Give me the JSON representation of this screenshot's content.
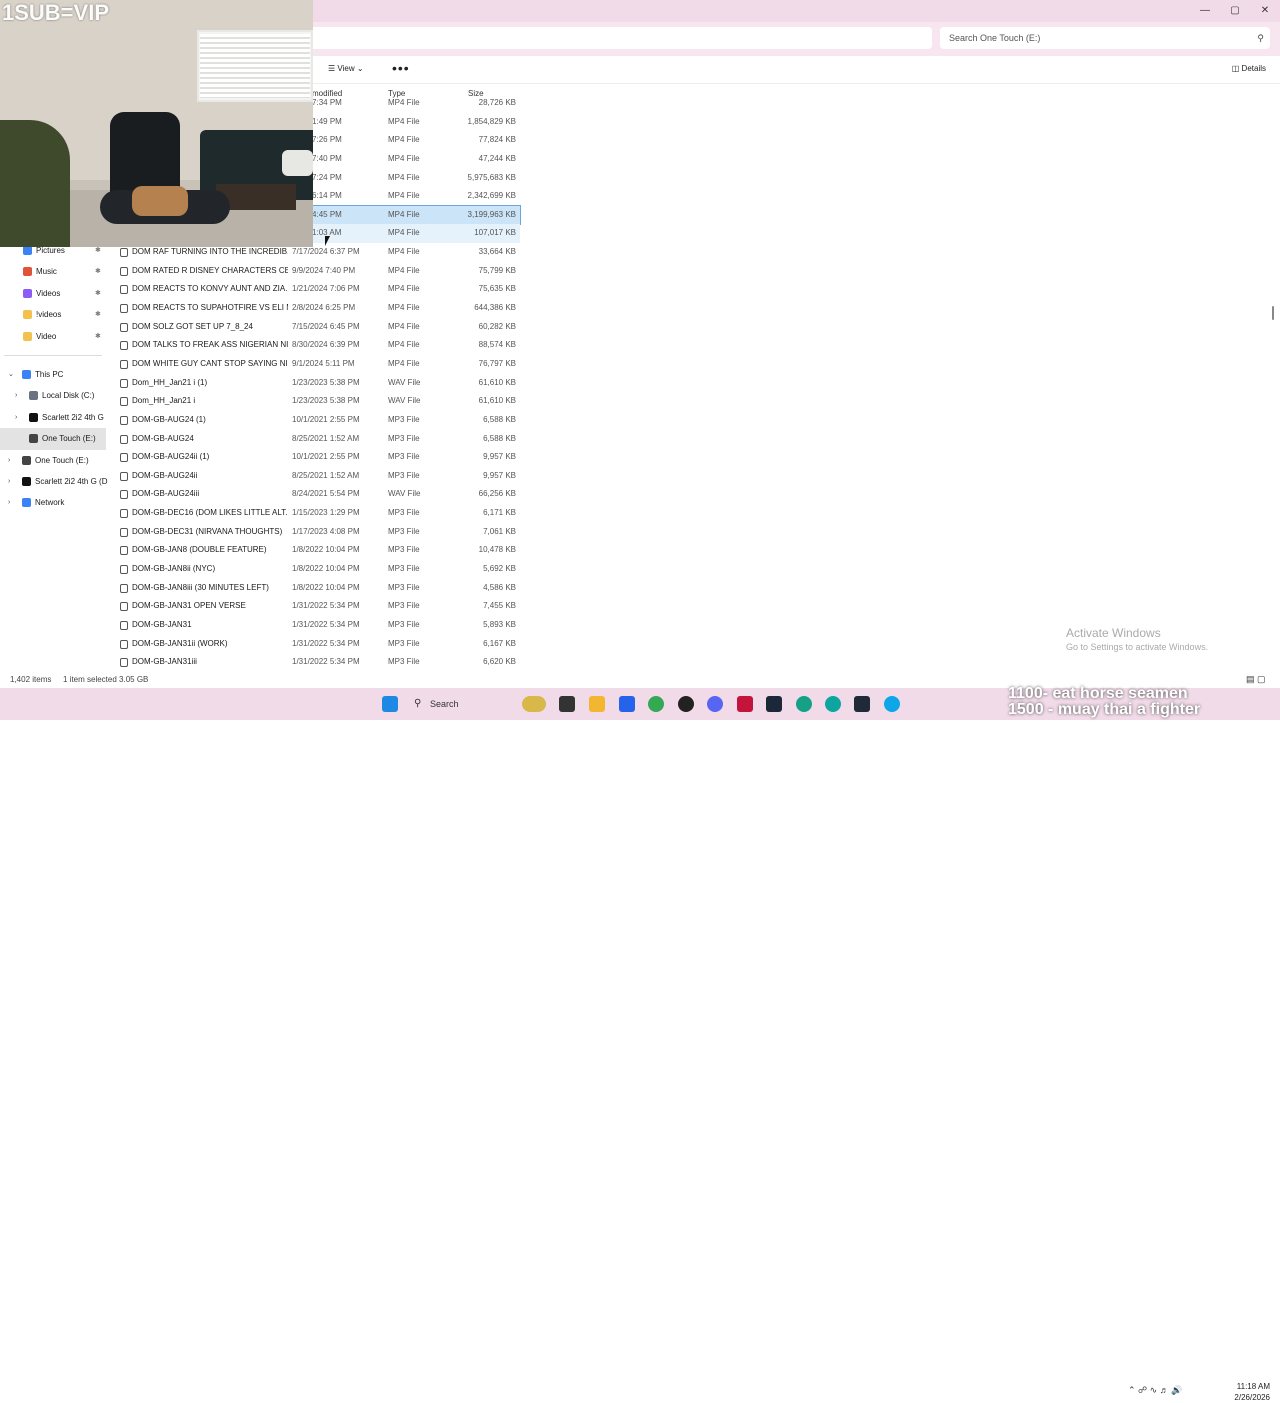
{
  "toolbar": {
    "view_label": "View",
    "more_label": "•••",
    "details_label": "Details"
  },
  "search": {
    "placeholder": "Search One Touch (E:)"
  },
  "columns": {
    "modified": "modified",
    "type": "Type",
    "size": "Size"
  },
  "files": [
    {
      "name": "",
      "date": "2024 7:34 PM",
      "type": "MP4 File",
      "size": "28,726 KB"
    },
    {
      "name": "",
      "date": "2024 1:49 PM",
      "type": "MP4 File",
      "size": "1,854,829 KB"
    },
    {
      "name": "",
      "date": "2024 7:26 PM",
      "type": "MP4 File",
      "size": "77,824 KB"
    },
    {
      "name": "",
      "date": "2024 7:40 PM",
      "type": "MP4 File",
      "size": "47,244 KB"
    },
    {
      "name": "",
      "date": "2024 7:24 PM",
      "type": "MP4 File",
      "size": "5,975,683 KB"
    },
    {
      "name": "",
      "date": "2024 6:14 PM",
      "type": "MP4 File",
      "size": "2,342,699 KB"
    },
    {
      "name": "",
      "date": "2024 4:45 PM",
      "type": "MP4 File",
      "size": "3,199,963 KB",
      "selected": true
    },
    {
      "name": "",
      "date": "2023 1:03 AM",
      "type": "MP4 File",
      "size": "107,017 KB",
      "hover": true
    },
    {
      "name": "DOM RAF TURNING INTO THE INCREDIB...",
      "date": "7/17/2024 6:37 PM",
      "type": "MP4 File",
      "size": "33,664 KB"
    },
    {
      "name": "DOM RATED R DISNEY CHARACTERS CE...",
      "date": "9/9/2024 7:40 PM",
      "type": "MP4 File",
      "size": "75,799 KB"
    },
    {
      "name": "DOM REACTS TO KONVY AUNT AND ZIA...",
      "date": "1/21/2024 7:06 PM",
      "type": "MP4 File",
      "size": "75,635 KB"
    },
    {
      "name": "DOM REACTS TO SUPAHOTFIRE VS ELI M...",
      "date": "2/8/2024 6:25 PM",
      "type": "MP4 File",
      "size": "644,386 KB"
    },
    {
      "name": "DOM SOLZ GOT SET UP 7_8_24",
      "date": "7/15/2024 6:45 PM",
      "type": "MP4 File",
      "size": "60,282 KB"
    },
    {
      "name": "DOM TALKS TO FREAK ASS NIGERIAN NI...",
      "date": "8/30/2024 6:39 PM",
      "type": "MP4 File",
      "size": "88,574 KB"
    },
    {
      "name": "DOM WHITE GUY CANT STOP SAYING NI...",
      "date": "9/1/2024 5:11 PM",
      "type": "MP4 File",
      "size": "76,797 KB"
    },
    {
      "name": "Dom_HH_Jan21 i (1)",
      "date": "1/23/2023 5:38 PM",
      "type": "WAV File",
      "size": "61,610 KB"
    },
    {
      "name": "Dom_HH_Jan21 i",
      "date": "1/23/2023 5:38 PM",
      "type": "WAV File",
      "size": "61,610 KB"
    },
    {
      "name": "DOM-GB-AUG24 (1)",
      "date": "10/1/2021 2:55 PM",
      "type": "MP3 File",
      "size": "6,588 KB"
    },
    {
      "name": "DOM-GB-AUG24",
      "date": "8/25/2021 1:52 AM",
      "type": "MP3 File",
      "size": "6,588 KB"
    },
    {
      "name": "DOM-GB-AUG24ii (1)",
      "date": "10/1/2021 2:55 PM",
      "type": "MP3 File",
      "size": "9,957 KB"
    },
    {
      "name": "DOM-GB-AUG24ii",
      "date": "8/25/2021 1:52 AM",
      "type": "MP3 File",
      "size": "9,957 KB"
    },
    {
      "name": "DOM-GB-AUG24iii",
      "date": "8/24/2021 5:54 PM",
      "type": "WAV File",
      "size": "66,256 KB"
    },
    {
      "name": "DOM-GB-DEC16 (DOM LIKES LITTLE ALT...",
      "date": "1/15/2023 1:29 PM",
      "type": "MP3 File",
      "size": "6,171 KB"
    },
    {
      "name": "DOM-GB-DEC31 (NIRVANA THOUGHTS)",
      "date": "1/17/2023 4:08 PM",
      "type": "MP3 File",
      "size": "7,061 KB"
    },
    {
      "name": "DOM-GB-JAN8 (DOUBLE FEATURE)",
      "date": "1/8/2022 10:04 PM",
      "type": "MP3 File",
      "size": "10,478 KB"
    },
    {
      "name": "DOM-GB-JAN8ii (NYC)",
      "date": "1/8/2022 10:04 PM",
      "type": "MP3 File",
      "size": "5,692 KB"
    },
    {
      "name": "DOM-GB-JAN8iii (30 MINUTES LEFT)",
      "date": "1/8/2022 10:04 PM",
      "type": "MP3 File",
      "size": "4,586 KB"
    },
    {
      "name": "DOM-GB-JAN31 OPEN VERSE",
      "date": "1/31/2022 5:34 PM",
      "type": "MP3 File",
      "size": "7,455 KB"
    },
    {
      "name": "DOM-GB-JAN31",
      "date": "1/31/2022 5:34 PM",
      "type": "MP3 File",
      "size": "5,893 KB"
    },
    {
      "name": "DOM-GB-JAN31ii (WORK)",
      "date": "1/31/2022 5:34 PM",
      "type": "MP3 File",
      "size": "6,167 KB"
    },
    {
      "name": "DOM-GB-JAN31iii",
      "date": "1/31/2022 5:34 PM",
      "type": "MP3 File",
      "size": "6,620 KB"
    }
  ],
  "sidebar": {
    "quick": [
      {
        "label": "Pictures",
        "color": "#3b82f6"
      },
      {
        "label": "Music",
        "color": "#e0523a"
      },
      {
        "label": "Videos",
        "color": "#8b5cf6"
      },
      {
        "label": "!videos",
        "color": "#f2c14e"
      },
      {
        "label": "Video",
        "color": "#f2c14e"
      }
    ],
    "tree": [
      {
        "label": "This PC",
        "indent": 0,
        "chev": "⌄",
        "color": "#3b82f6"
      },
      {
        "label": "Local Disk (C:)",
        "indent": 1,
        "chev": "›",
        "color": "#6b7280"
      },
      {
        "label": "Scarlett 2i2 4th G",
        "indent": 1,
        "chev": "›",
        "color": "#111111"
      },
      {
        "label": "One Touch (E:)",
        "indent": 1,
        "chev": "",
        "color": "#444444",
        "active": true
      },
      {
        "label": "One Touch (E:)",
        "indent": 0,
        "chev": "›",
        "color": "#444444"
      },
      {
        "label": "Scarlett 2i2 4th G (D",
        "indent": 0,
        "chev": "›",
        "color": "#111111"
      },
      {
        "label": "Network",
        "indent": 0,
        "chev": "›",
        "color": "#3b82f6"
      }
    ]
  },
  "status": {
    "items": "1,402 items",
    "selected": "1 item selected  3.05 GB"
  },
  "activation": {
    "title": "Activate Windows",
    "subtitle": "Go to Settings to activate Windows."
  },
  "watermark": "1SUB=VIP",
  "overlay": {
    "line1": "1100- eat horse seamen",
    "line2": "1500 - muay thai a fighter"
  },
  "clock": {
    "time": "11:18 AM",
    "date": "2/26/2026"
  },
  "taskbar": {
    "search_label": "Search"
  },
  "colors": {
    "titlebar": "#f2dbe9",
    "selected_row": "#cce4f7",
    "taskbar": "#f2dbe9"
  }
}
